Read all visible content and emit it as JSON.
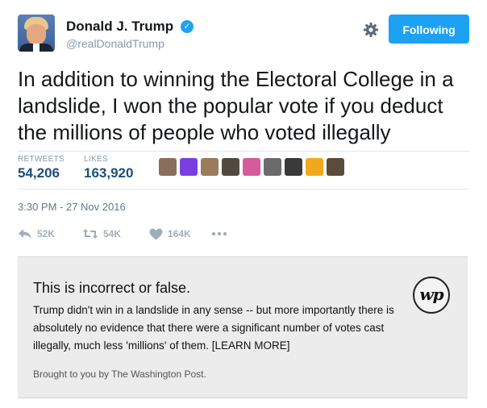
{
  "author": {
    "display_name": "Donald J. Trump",
    "handle": "@realDonaldTrump",
    "verified": true
  },
  "header": {
    "follow_label": "Following",
    "settings_icon": "gear-icon"
  },
  "tweet": {
    "text": "In addition to winning the Electoral College in a landslide, I won the popular vote if you deduct the millions of people who voted illegally",
    "timestamp": "3:30 PM - 27 Nov 2016"
  },
  "stats": {
    "retweets_label": "RETWEETS",
    "retweets_value": "54,206",
    "likes_label": "LIKES",
    "likes_value": "163,920"
  },
  "liker_avatars": [
    {
      "color": "#8a6d5a"
    },
    {
      "color": "#7b3fe0"
    },
    {
      "color": "#9c7a5b"
    },
    {
      "color": "#4f4a3f"
    },
    {
      "color": "#d65a9c"
    },
    {
      "color": "#6b6b6b"
    },
    {
      "color": "#3a3a3a"
    },
    {
      "color": "#f2a81d"
    },
    {
      "color": "#5a4b3c"
    }
  ],
  "actions": {
    "reply_count": "52K",
    "retweet_count": "54K",
    "like_count": "164K",
    "more_icon": "more-icon"
  },
  "factcheck": {
    "title": "This is incorrect or false.",
    "body": "Trump didn't win in a landslide in any sense -- but more importantly there is absolutely no evidence that there were a significant number of votes cast illegally, much less 'millions' of them. [LEARN MORE]",
    "footer": "Brought to you by The Washington Post.",
    "logo_text": "wp"
  },
  "colors": {
    "accent": "#1da1f2",
    "stat_value": "#1b4f7a",
    "factcheck_bg": "#ececec"
  }
}
